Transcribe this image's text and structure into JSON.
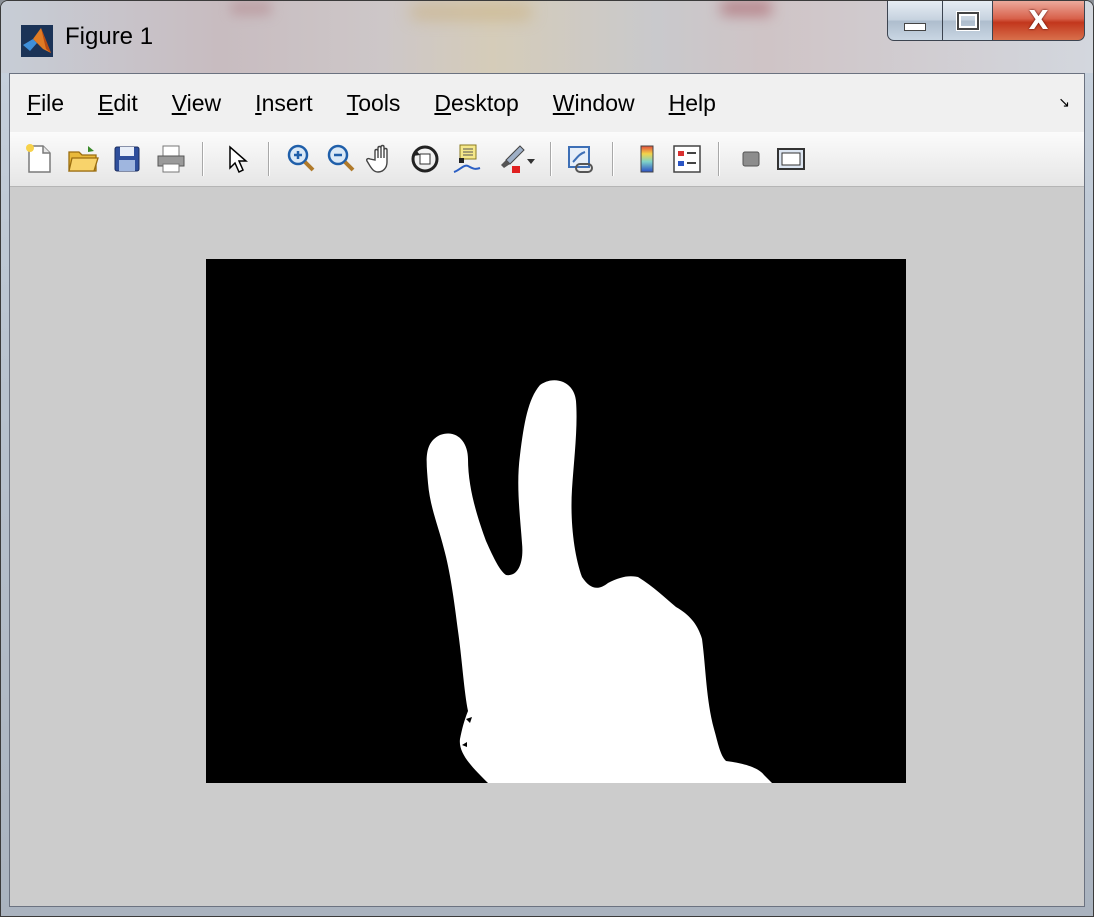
{
  "window": {
    "title": "Figure 1",
    "close_glyph": "X"
  },
  "menu": {
    "items": [
      {
        "accel": "F",
        "rest": "ile"
      },
      {
        "accel": "E",
        "rest": "dit"
      },
      {
        "accel": "V",
        "rest": "iew"
      },
      {
        "accel": "I",
        "rest": "nsert"
      },
      {
        "accel": "T",
        "rest": "ools"
      },
      {
        "accel": "D",
        "rest": "esktop"
      },
      {
        "accel": "W",
        "rest": "indow"
      },
      {
        "accel": "H",
        "rest": "elp"
      }
    ],
    "dock_glyph": "↘"
  },
  "toolbar": {
    "icons": [
      "new-figure-icon",
      "open-file-icon",
      "save-icon",
      "print-icon",
      "edit-plot-arrow-icon",
      "zoom-in-icon",
      "zoom-out-icon",
      "pan-hand-icon",
      "rotate-3d-icon",
      "data-cursor-icon",
      "brush-icon",
      "link-plot-icon",
      "colorbar-icon",
      "legend-icon",
      "hide-plot-tools-icon",
      "show-plot-tools-icon"
    ]
  },
  "colors": {
    "figure_bg": "#cccccc",
    "axes_bg": "#000000",
    "mask_fg": "#ffffff"
  }
}
